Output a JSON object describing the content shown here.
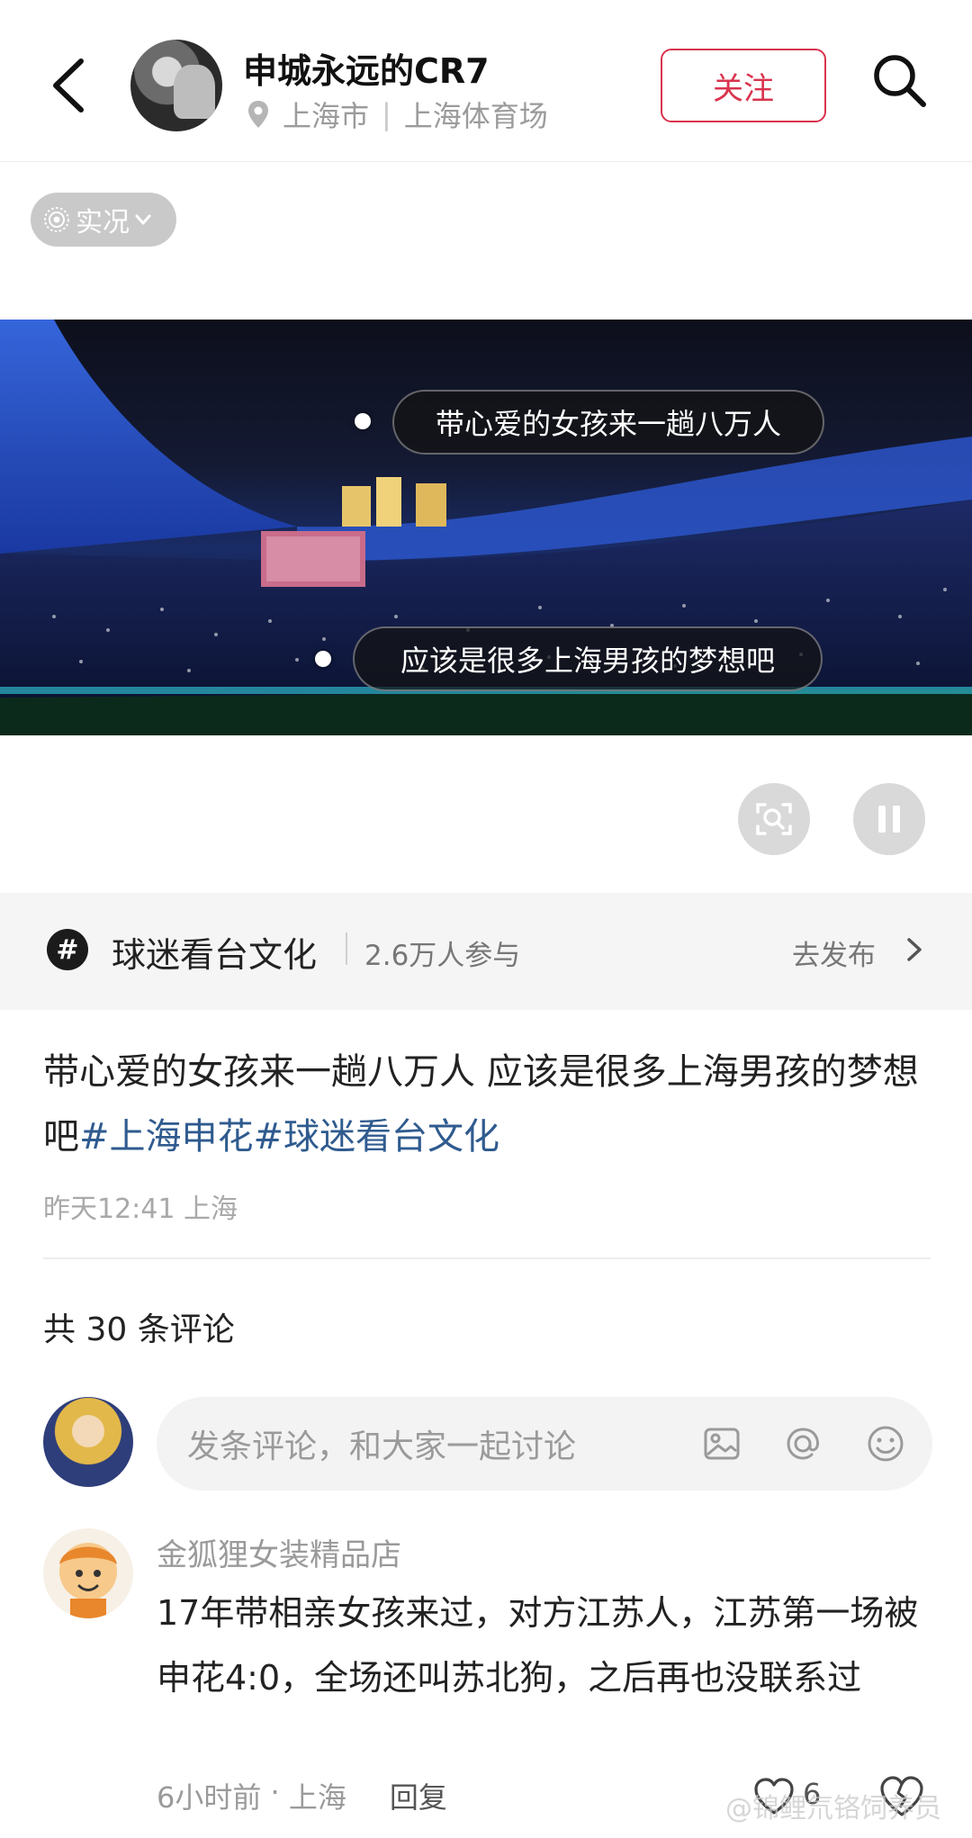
{
  "header": {
    "user_name": "申城永远的CR7",
    "city": "上海市",
    "venue": "上海体育场",
    "follow_label": "关注"
  },
  "live_badge": {
    "label": "实况"
  },
  "photo": {
    "tags": [
      {
        "text": "带心爱的女孩来一趟八万人"
      },
      {
        "text": "应该是很多上海男孩的梦想吧"
      }
    ]
  },
  "topic": {
    "icon": "#",
    "name": "球迷看台文化",
    "participants": "2.6万人参与",
    "publish_label": "去发布"
  },
  "post": {
    "text": "带心爱的女孩来一趟八万人 应该是很多上海男孩的梦想吧",
    "hashtags": [
      "#上海申花",
      "#球迷看台文化"
    ],
    "time": "昨天12:41",
    "location": "上海"
  },
  "comments_header": "共 30 条评论",
  "comment_input": {
    "placeholder": "发条评论，和大家一起讨论"
  },
  "comments": [
    {
      "author": "金狐狸女装精品店",
      "text": "17年带相亲女孩来过，对方江苏人，江苏第一场被申花4:0，全场还叫苏北狗，之后再也没联系过",
      "time": "6小时前",
      "location": "上海",
      "reply_label": "回复",
      "likes": "6"
    }
  ],
  "watermark": "@锦鲤氘铬饲养员",
  "colors": {
    "accent": "#d9344e",
    "hashtag": "#2f5b8f",
    "topic_bg": "#f5f5f5"
  }
}
